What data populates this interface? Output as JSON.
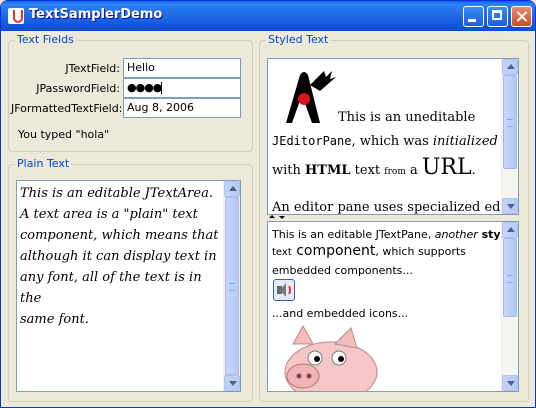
{
  "window": {
    "title": "TextSamplerDemo"
  },
  "text_fields": {
    "legend": "Text Fields",
    "jtextfield_label": "JTextField:",
    "jtextfield_value": "Hello",
    "jpasswordfield_label": "JPasswordField:",
    "jpasswordfield_value": "●●●●",
    "jformatted_label": "JFormattedTextField:",
    "jformatted_value": "Aug 8, 2006",
    "status": "You typed \"hola\""
  },
  "plain_text": {
    "legend": "Plain Text",
    "lines": [
      "This is an editable JTextArea.",
      "A text area is a \"plain\" text",
      "component, which means that",
      "although it can display text in",
      "any font, all of the text is in the",
      "same font."
    ]
  },
  "styled_text": {
    "legend": "Styled Text",
    "editor_pane": {
      "l1": "This is an uneditable",
      "l2_mono": "JEditorPane",
      "l2_a": ", which was ",
      "l2_i": "initialized",
      "l3_a": "with ",
      "l3_b": "HTML",
      "l3_c": " text ",
      "l3_d": "from",
      "l3_e": " a ",
      "l3_url": "URL",
      "l3_f": ".",
      "l4": "An editor pane uses specialized editor"
    },
    "text_pane": {
      "l1_a": "This is an editable JTextPane, ",
      "l1_i": "another",
      "l1_b": " styled",
      "l2_a": "text",
      "l2_big": " component",
      "l2_b": ", which supports",
      "l3": "embedded components...",
      "l4": "...and embedded icons..."
    }
  }
}
